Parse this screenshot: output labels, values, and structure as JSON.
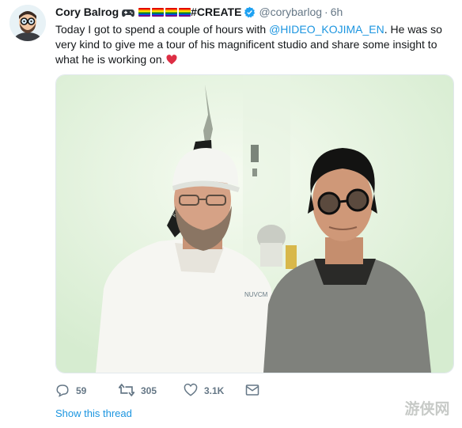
{
  "tweet": {
    "author_name": "Cory Balrog",
    "create_tag": "#CREATE",
    "handle": "@corybarlog",
    "separator": "·",
    "time": "6h",
    "text_before_mention": "Today I got to spend a couple of hours with ",
    "mention": "@HIDEO_KOJIMA_EN",
    "text_after_mention": ". He was so very kind to give me a tour of his magnificent studio and share some insight to what he is working on."
  },
  "actions": {
    "reply_count": "59",
    "retweet_count": "305",
    "like_count": "3.1K"
  },
  "show_thread_label": "Show this thread",
  "watermark_text": "游侠网",
  "colors": {
    "link": "#1b95e0",
    "muted": "#657786",
    "verified": "#1da1f2",
    "heart": "#e0245e"
  },
  "icons": [
    "avatar-cartoon",
    "gamepad-icon",
    "rainbow-flag-icon",
    "verified-icon",
    "heart-emoji-icon",
    "reply-icon",
    "retweet-icon",
    "like-icon",
    "message-icon"
  ]
}
